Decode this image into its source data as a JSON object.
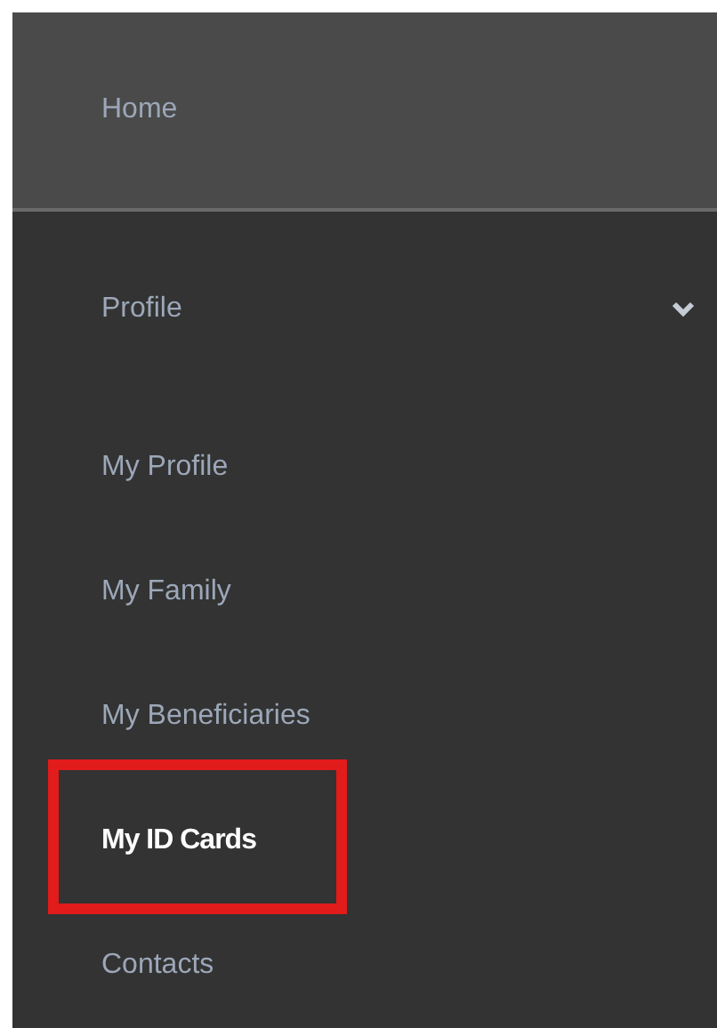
{
  "home": {
    "label": "Home"
  },
  "section": {
    "label": "Profile",
    "expanded": true,
    "items": [
      {
        "label": "My Profile",
        "selected": false,
        "highlighted": false
      },
      {
        "label": "My Family",
        "selected": false,
        "highlighted": false
      },
      {
        "label": "My Beneficiaries",
        "selected": false,
        "highlighted": false
      },
      {
        "label": "My ID Cards",
        "selected": true,
        "highlighted": true
      },
      {
        "label": "Contacts",
        "selected": false,
        "highlighted": false
      }
    ]
  }
}
